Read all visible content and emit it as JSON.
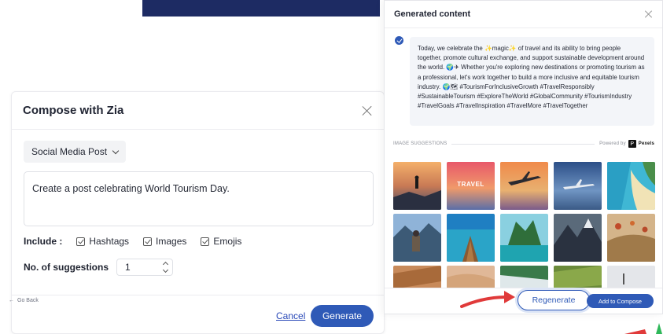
{
  "compose": {
    "title": "Compose with Zia",
    "post_type": "Social Media Post",
    "prompt": "Create a post celebrating World Tourism Day.",
    "include_label": "Include :",
    "include_options": [
      "Hashtags",
      "Images",
      "Emojis"
    ],
    "suggestions_label": "No. of suggestions",
    "suggestions_value": "1",
    "cancel_label": "Cancel",
    "generate_label": "Generate"
  },
  "generated": {
    "title": "Generated content",
    "text_part1": "Today, we celebrate the",
    "text_magic": "magic",
    "text_part2": "of travel and its ability to bring people together, promote cultural exchange, and support sustainable development around the world.",
    "text_part3": "Whether you're exploring new destinations or promoting tourism as a professional, let's work together to build a more inclusive and equitable tourism industry.",
    "text_hashtags": "#TourismForInclusiveGrowth #TravelResponsibly #SustainableTourism #ExploreTheWorld #GlobalCommunity #TourismIndustry #TravelGoals #TravelInspiration #TravelMore #TravelTogether",
    "image_suggestions_label": "IMAGE SUGGESTIONS",
    "powered_by": "Powered by",
    "powered_brand": "Pexels",
    "travel_thumb_label": "TRAVEL",
    "go_back_label": "Go Back",
    "regenerate_label": "Regenerate",
    "add_to_compose_label": "Add to Compose"
  },
  "colors": {
    "primary": "#2f5ab7",
    "navy_header": "#1d2b63",
    "annotation_arrow": "#e03a3a"
  }
}
